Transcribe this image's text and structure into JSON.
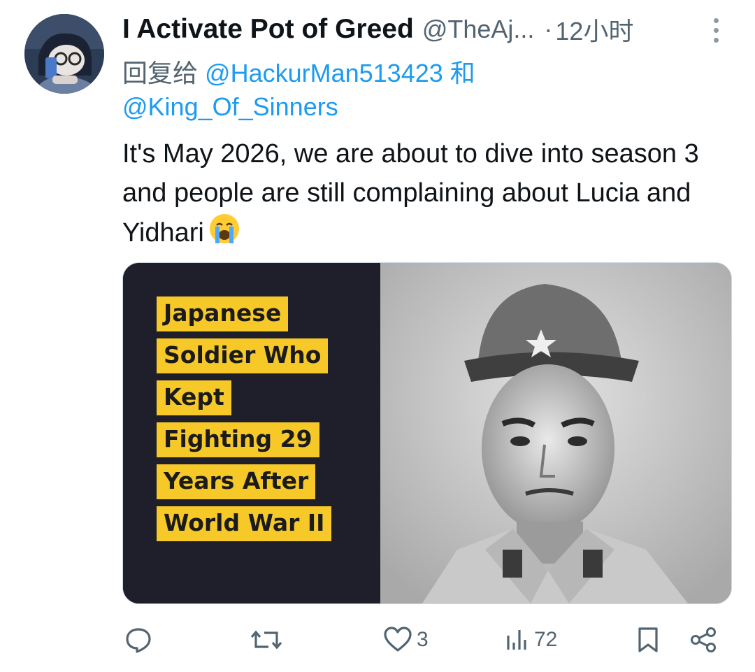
{
  "tweet": {
    "display_name": "I Activate Pot of Greed",
    "handle": "@TheAj...",
    "separator": "·",
    "time": "12小时",
    "reply_prefix": "回复给",
    "reply_to_1": "@HackurMan513423",
    "reply_joiner": "和",
    "reply_to_2": "@King_Of_Sinners",
    "text": "It's May 2026, we are about to dive into season 3 and people are still complaining about Lucia and Yidhari",
    "emoji": "crying-face-emoji"
  },
  "media": {
    "caption_lines": [
      "Japanese",
      "Soldier Who",
      "Kept",
      "Fighting 29",
      "Years After",
      "World War II"
    ],
    "photo_icon": "soldier-portrait"
  },
  "actions": {
    "reply_count": "",
    "retweet_count": "",
    "like_count": "3",
    "views_count": "72"
  },
  "colors": {
    "accent": "#1d9bf0",
    "secondary_text": "#536471",
    "caption_bg": "#f7c928",
    "media_dark_bg": "#1e1f2b"
  }
}
